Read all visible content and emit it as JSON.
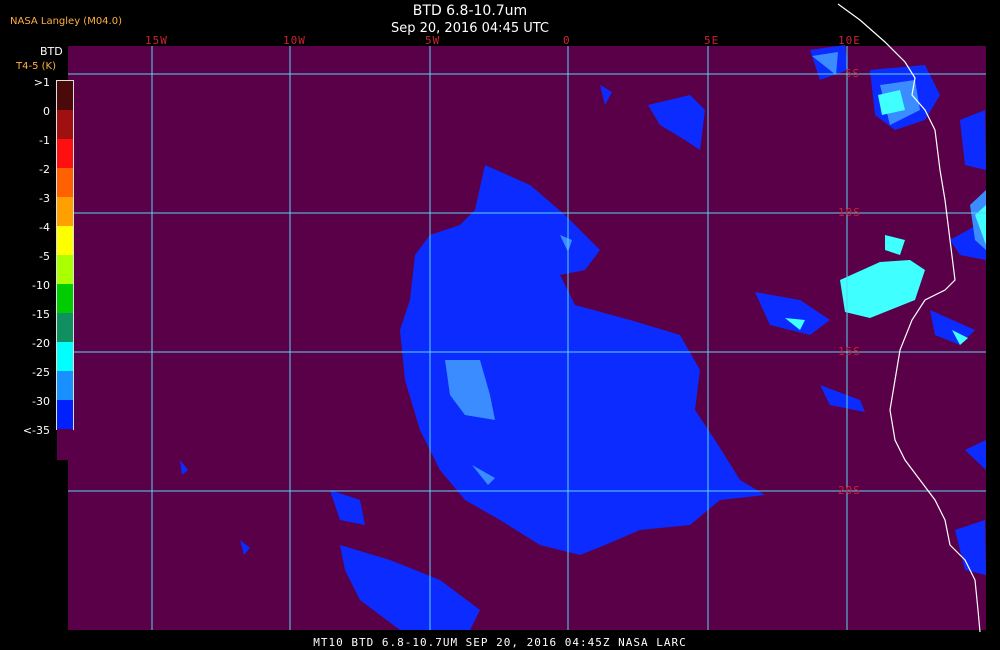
{
  "source": "NASA Langley (M04.0)",
  "title": "BTD 6.8-10.7um",
  "datetime": "Sep 20, 2016 04:45 UTC",
  "longitude_labels": [
    "15W",
    "10W",
    "5W",
    "0",
    "5E",
    "10E"
  ],
  "latitude_labels": [
    "5S",
    "10S",
    "15S",
    "20S"
  ],
  "legend": {
    "title": "BTD",
    "subtitle": "T4-5 (K)",
    "ticks": [
      ">1",
      "0",
      "-1",
      "-2",
      "-3",
      "-4",
      "-5",
      "-10",
      "-15",
      "-20",
      "-25",
      "-30",
      "<-35"
    ],
    "colors": [
      "#4a0a0a",
      "#a01010",
      "#ff1010",
      "#ff6000",
      "#ffa000",
      "#ffff00",
      "#aaff00",
      "#00cc00",
      "#109060",
      "#00ffff",
      "#1890ff",
      "#0020ff",
      "#5a0048"
    ]
  },
  "colors": {
    "background": "#5a0048",
    "grid": "#5ad4f0",
    "coast": "#ffffff",
    "cloud_cold": "#0c2cff",
    "cloud_mid": "#3a8cff",
    "cloud_warm": "#40ffff"
  },
  "footer": "MT10  BTD 6.8-10.7UM  SEP 20, 2016 04:45Z  NASA LARC"
}
